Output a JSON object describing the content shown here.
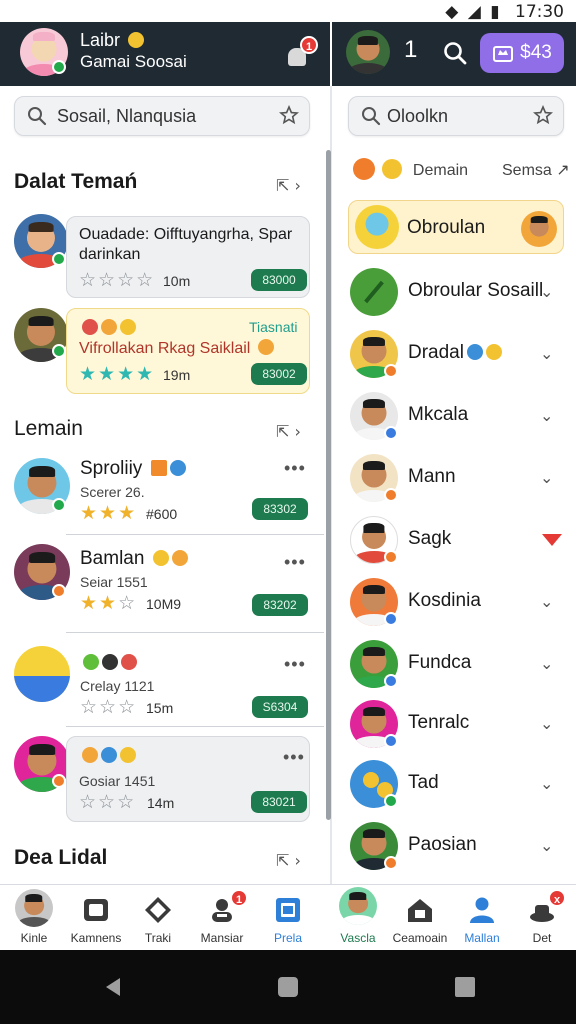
{
  "status_bar": {
    "time": "17:30",
    "icons": [
      "wifi-icon",
      "signal-icon",
      "battery-icon"
    ]
  },
  "profile": {
    "name": "Laibr",
    "subtitle": "Gamai Soosai",
    "notification_count": "1"
  },
  "right_header": {
    "count": "1",
    "coins": "$43"
  },
  "search_left": {
    "placeholder": "Sosail, Nlanqusia"
  },
  "search_right": {
    "placeholder": "Oloolkn"
  },
  "friends_section": {
    "title": "Dalat Temań",
    "cards": [
      {
        "text": "Ouadade: Oifftuyangrha, Spar darinkan",
        "stars": 0,
        "distance": "10m",
        "badge": "83000"
      },
      {
        "label": "Tiasnati",
        "text": "Vifrollakan Rkag Saiklail",
        "stars": 4,
        "distance": "19m",
        "badge": "83002"
      }
    ]
  },
  "lemain_section": {
    "title": "Lemain",
    "rows": [
      {
        "name": "Sproliiy",
        "sub": "Scerer 26.",
        "stars_on": 3,
        "stars_total": 3,
        "distance": "#600",
        "badge": "83302"
      },
      {
        "name": "Bamlan",
        "sub": "Seiar 1551",
        "stars_on": 2,
        "stars_total": 3,
        "distance": "10M9",
        "badge": "83202"
      },
      {
        "name": "",
        "sub": "Crelay 1121",
        "stars_on": 0,
        "stars_total": 3,
        "distance": "15m",
        "badge": "S6304"
      },
      {
        "name": "",
        "sub": "Gosiar 1451",
        "stars_on": 0,
        "stars_total": 3,
        "distance": "14m",
        "badge": "83021"
      }
    ]
  },
  "dea_section": {
    "title": "Dea Lidal"
  },
  "right_panel": {
    "header_left": "Demain",
    "header_right": "Semsa",
    "selected_item": "Obroulan",
    "items": [
      {
        "name": "Obroular Sosaill",
        "dot": "none",
        "color": "#4a9e3a"
      },
      {
        "name": "Dradal",
        "dot": "orange",
        "color": "#f0c64a"
      },
      {
        "name": "Mkcala",
        "dot": "blue",
        "color": "#ffffff"
      },
      {
        "name": "Mann",
        "dot": "orange",
        "color": "#f3e3c5"
      },
      {
        "name": "Sagk",
        "dot": "orange",
        "color": "#ffffff"
      },
      {
        "name": "Kosdinia",
        "dot": "blue",
        "color": "#f07a3a"
      },
      {
        "name": "Fundca",
        "dot": "blue",
        "color": "#3a9e3a"
      },
      {
        "name": "Tenralc",
        "dot": "blue",
        "color": "#e0249a"
      },
      {
        "name": "Tad",
        "dot": "green",
        "color": "#3a8fd8"
      },
      {
        "name": "Paosian",
        "dot": "orange",
        "color": "#3a8a3a"
      }
    ]
  },
  "bottom_nav": [
    {
      "label": "Kinle",
      "icon": "avatar-icon"
    },
    {
      "label": "Kamnens",
      "icon": "camera-icon"
    },
    {
      "label": "Traki",
      "icon": "diamond-icon"
    },
    {
      "label": "Mansiar",
      "icon": "user-badge-icon",
      "badge": "1"
    },
    {
      "label": "Prela",
      "icon": "square-icon",
      "active": true
    },
    {
      "label": "Vascla",
      "icon": "avatar-icon",
      "active_green": true
    },
    {
      "label": "Ceamoain",
      "icon": "home-icon"
    },
    {
      "label": "Mallan",
      "icon": "person-icon",
      "active": true
    },
    {
      "label": "Det",
      "icon": "hat-icon",
      "badge": "x"
    }
  ],
  "colors": {
    "topbar": "#1f2a33",
    "accent_purple": "#8f6ee8",
    "pill_green": "#1e7a4f",
    "nav_active": "#2d7fd8",
    "badge_red": "#e53935"
  }
}
